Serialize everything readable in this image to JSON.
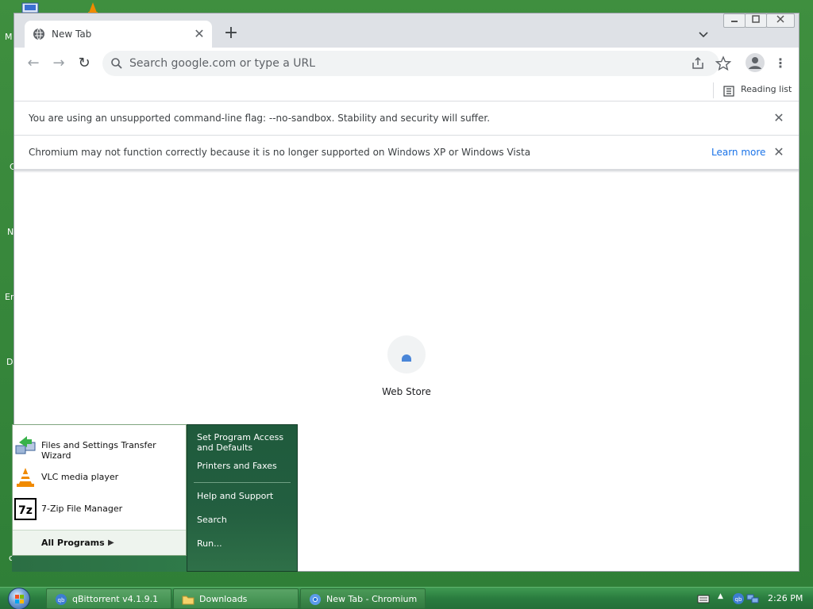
{
  "desktop": {
    "side_letters": [
      "M",
      "C",
      "N",
      "Er",
      "D",
      "c"
    ]
  },
  "browser": {
    "tab": {
      "title": "New Tab",
      "close": "✕"
    },
    "new_tab": "+",
    "tab_search": "chevron-down-icon",
    "window_controls": [
      "minimize",
      "maximize",
      "close"
    ],
    "toolbar": {
      "back": "←",
      "forward": "→",
      "reload": "↻",
      "omnibox_placeholder": "Search google.com or type a URL",
      "menu": "⋮"
    },
    "bookmarks_bar": {
      "reading_list": "Reading list"
    },
    "infobars": [
      {
        "text": "You are using an unsupported command-line flag: --no-sandbox. Stability and security will suffer."
      },
      {
        "text": "Chromium may not function correctly because it is no longer supported on Windows XP or Windows Vista",
        "link": "Learn more"
      }
    ],
    "newtab_page": {
      "shortcut_label": "Web Store"
    }
  },
  "start_menu": {
    "pinned": [
      {
        "label": "Files and Settings Transfer Wizard",
        "icon": "transfer-wizard-icon"
      },
      {
        "label": "VLC media player",
        "icon": "vlc-icon"
      },
      {
        "label": "7-Zip File Manager",
        "icon": "7zip-icon"
      }
    ],
    "all_programs": "All Programs",
    "right_items": [
      "Set Program Access and Defaults",
      "Printers and Faxes",
      "Help and Support",
      "Search",
      "Run..."
    ]
  },
  "taskbar": {
    "buttons": [
      {
        "label": "qBittorrent v4.1.9.1",
        "icon": "qbittorrent-icon"
      },
      {
        "label": "Downloads",
        "icon": "folder-icon"
      },
      {
        "label": "New Tab - Chromium",
        "icon": "chromium-icon",
        "active": true
      }
    ],
    "clock": "2:26 PM"
  },
  "colors": {
    "accent_link": "#1a73e8",
    "start_menu_right": "#1f5a3c",
    "taskbar": "#2a7c3f"
  }
}
